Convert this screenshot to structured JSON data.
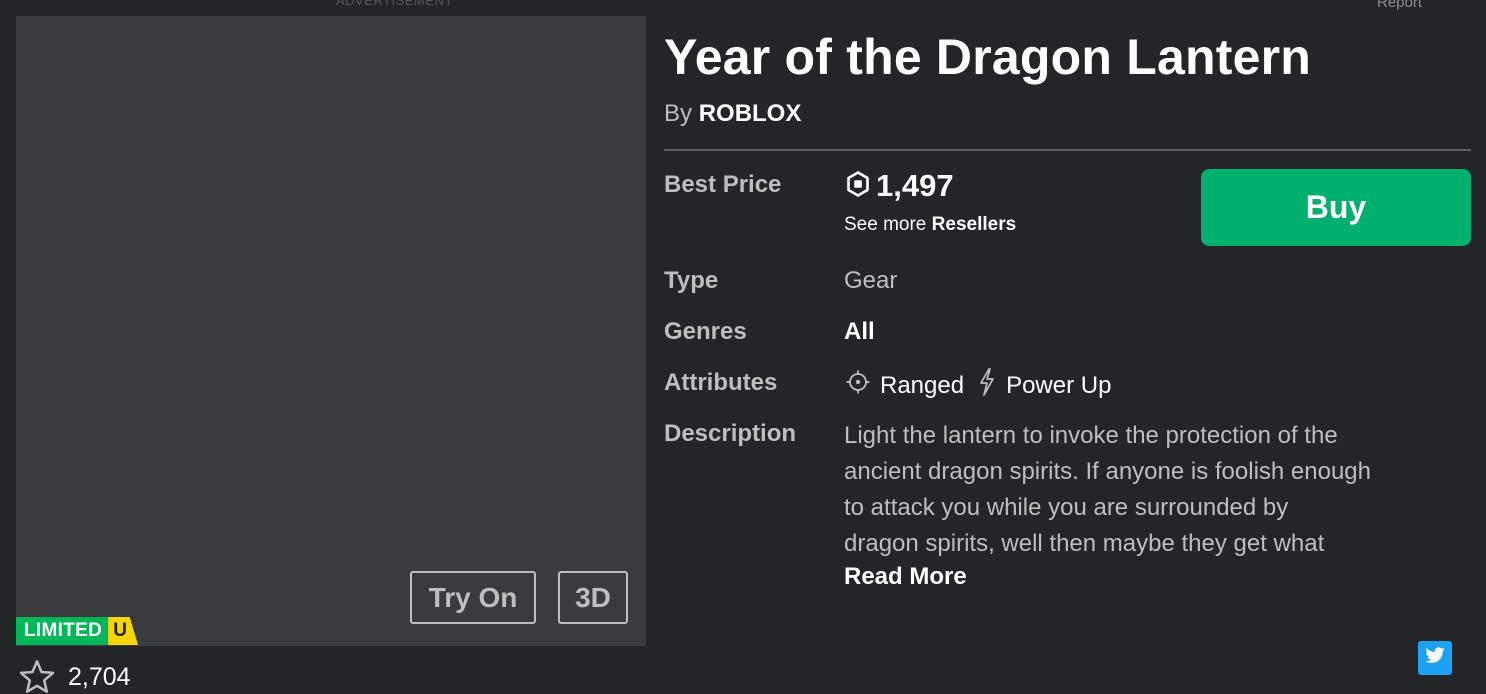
{
  "header": {
    "ad_label": "ADVERTISEMENT",
    "report_label": "Report"
  },
  "thumbnail": {
    "try_on_label": "Try On",
    "three_d_label": "3D",
    "badge_text": "LIMITED",
    "badge_suffix": "U",
    "badge_colors": {
      "limited": "#02b757",
      "unique": "#f4d50b"
    }
  },
  "favorites": {
    "icon": "star-outline-icon",
    "count": "2,704"
  },
  "item": {
    "title": "Year of the Dragon Lantern",
    "by_prefix": "By",
    "creator": "ROBLOX"
  },
  "price": {
    "label": "Best Price",
    "currency_icon": "robux-icon",
    "amount": "1,497",
    "resellers_prefix": "See more",
    "resellers_link": "Resellers",
    "buy_label": "Buy",
    "buy_color": "#00b06f"
  },
  "details": {
    "type_label": "Type",
    "type_value": "Gear",
    "genres_label": "Genres",
    "genres_value": "All",
    "attributes_label": "Attributes",
    "attributes": [
      {
        "icon": "crosshair-icon",
        "label": "Ranged"
      },
      {
        "icon": "power-bolt-icon",
        "label": "Power Up"
      }
    ],
    "description_label": "Description",
    "description_lines": [
      "Light the lantern to invoke the protection of the",
      "ancient dragon spirits. If anyone is foolish enough",
      "to attack you while you are surrounded by",
      "dragon spirits, well then maybe they get what"
    ],
    "read_more": "Read More"
  },
  "share": {
    "twitter_icon": "twitter-icon",
    "twitter_color": "#1da1f2"
  }
}
